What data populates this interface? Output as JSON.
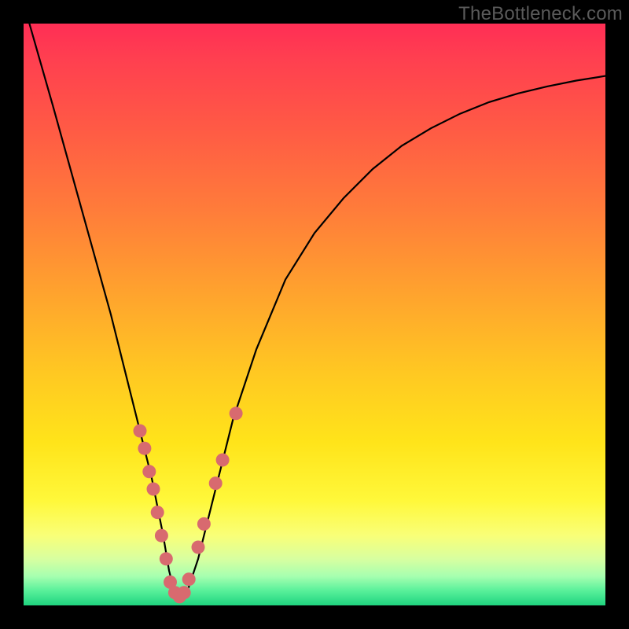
{
  "watermark": "TheBottleneck.com",
  "chart_data": {
    "type": "line",
    "title": "",
    "xlabel": "",
    "ylabel": "",
    "xlim": [
      0,
      100
    ],
    "ylim": [
      0,
      100
    ],
    "series": [
      {
        "name": "bottleneck-curve",
        "x": [
          1,
          5,
          10,
          15,
          18,
          20,
          22,
          24,
          25,
          26,
          27,
          28,
          30,
          33,
          36,
          40,
          45,
          50,
          55,
          60,
          65,
          70,
          75,
          80,
          85,
          90,
          95,
          100
        ],
        "y": [
          100,
          86,
          68,
          50,
          38,
          30,
          22,
          12,
          6,
          2,
          1,
          2,
          8,
          20,
          32,
          44,
          56,
          64,
          70,
          75,
          79,
          82,
          84.5,
          86.5,
          88,
          89.2,
          90.2,
          91
        ]
      }
    ],
    "markers": {
      "name": "highlight-dots",
      "color": "#d86a6f",
      "points": [
        {
          "x": 20.0,
          "y": 30
        },
        {
          "x": 20.8,
          "y": 27
        },
        {
          "x": 21.6,
          "y": 23
        },
        {
          "x": 22.3,
          "y": 20
        },
        {
          "x": 23.0,
          "y": 16
        },
        {
          "x": 23.7,
          "y": 12
        },
        {
          "x": 24.5,
          "y": 8
        },
        {
          "x": 25.2,
          "y": 4
        },
        {
          "x": 26.0,
          "y": 2.2
        },
        {
          "x": 26.8,
          "y": 1.5
        },
        {
          "x": 27.6,
          "y": 2.2
        },
        {
          "x": 28.4,
          "y": 4.5
        },
        {
          "x": 30.0,
          "y": 10
        },
        {
          "x": 31.0,
          "y": 14
        },
        {
          "x": 33.0,
          "y": 21
        },
        {
          "x": 34.2,
          "y": 25
        },
        {
          "x": 36.5,
          "y": 33
        }
      ]
    }
  }
}
